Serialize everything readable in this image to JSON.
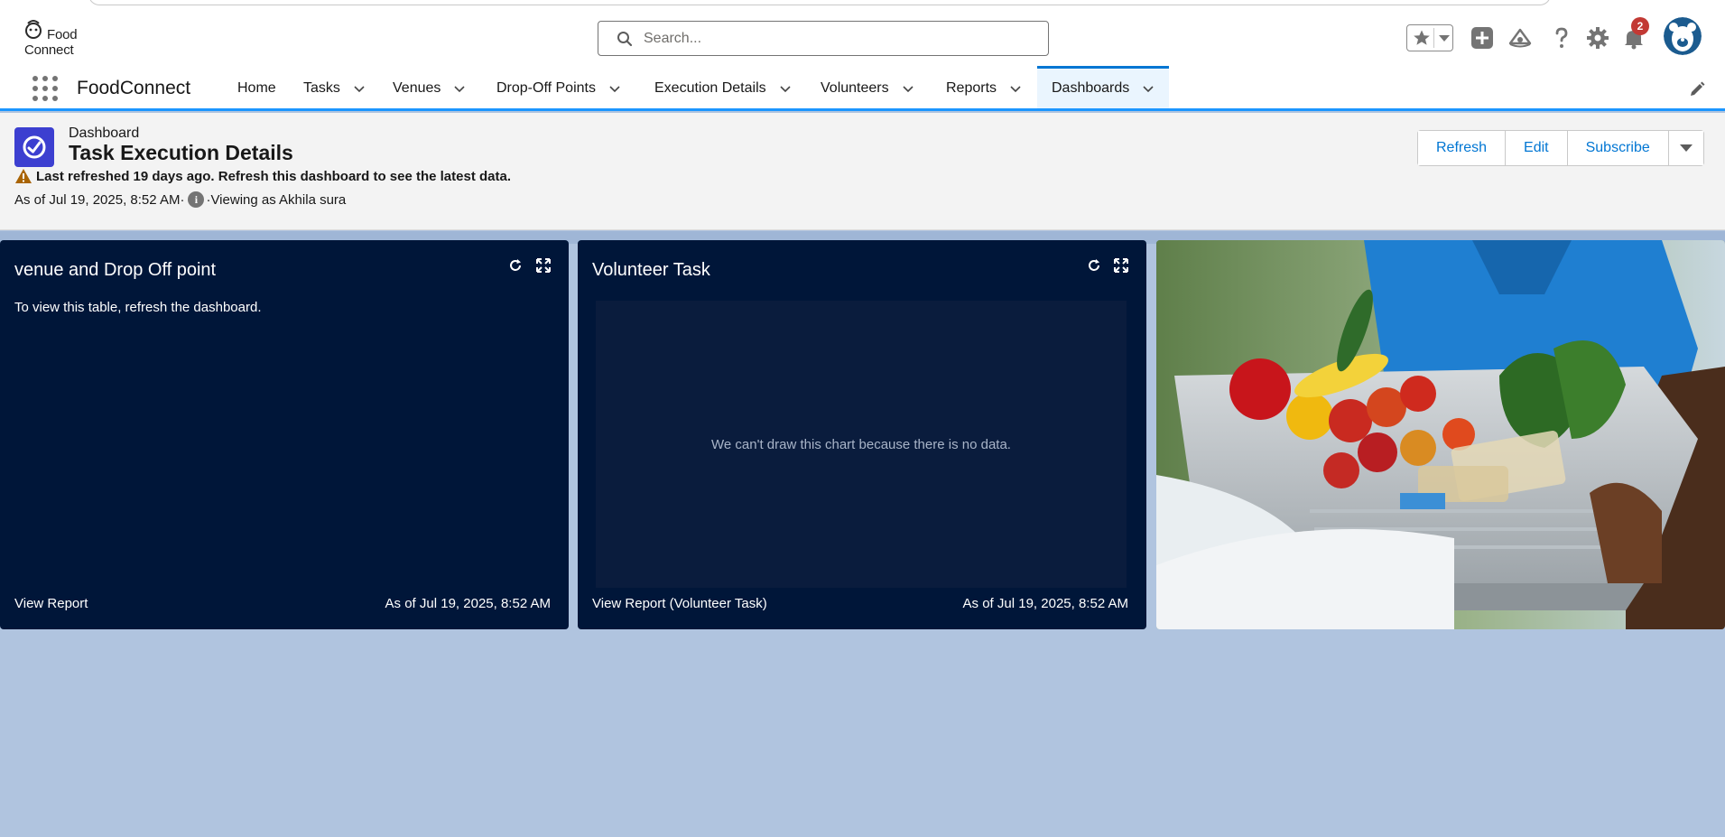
{
  "header": {
    "logo_line1": "Food",
    "logo_line2": "Connect",
    "search_placeholder": "Search...",
    "notification_count": "2"
  },
  "nav": {
    "app_name": "FoodConnect",
    "items": [
      {
        "label": "Home"
      },
      {
        "label": "Tasks"
      },
      {
        "label": "Venues"
      },
      {
        "label": "Drop-Off Points"
      },
      {
        "label": "Execution Details"
      },
      {
        "label": "Volunteers"
      },
      {
        "label": "Reports"
      },
      {
        "label": "Dashboards"
      }
    ]
  },
  "dashboard": {
    "type_label": "Dashboard",
    "title": "Task Execution Details",
    "warning": "Last refreshed 19 days ago. Refresh this dashboard to see the latest data.",
    "as_of": "As of Jul 19, 2025, 8:52 AM·",
    "viewing_as": "·Viewing as Akhila sura",
    "buttons": {
      "refresh": "Refresh",
      "edit": "Edit",
      "subscribe": "Subscribe"
    }
  },
  "widgets": [
    {
      "title": "venue and Drop Off point",
      "body": "To view this table, refresh the dashboard.",
      "footer_link": "View Report",
      "footer_time": "As of Jul 19, 2025, 8:52 AM"
    },
    {
      "title": "Volunteer Task",
      "body": "We can't draw this chart because there is no data.",
      "footer_link": "View Report (Volunteer Task)",
      "footer_time": "As of Jul 19, 2025, 8:52 AM"
    }
  ],
  "colors": {
    "accent": "#0176d3",
    "widget_bg": "#001639",
    "canvas_bg": "#b0c4df",
    "dashboard_icon": "#3c3fd0",
    "badge": "#c23934"
  },
  "icons": [
    "search-icon",
    "star-icon",
    "add-icon",
    "trailhead-icon",
    "help-icon",
    "gear-icon",
    "bell-icon",
    "app-launcher-icon",
    "chevron-down-icon",
    "pencil-icon",
    "dashboard-icon",
    "warning-icon",
    "info-icon",
    "refresh-icon",
    "expand-icon"
  ]
}
